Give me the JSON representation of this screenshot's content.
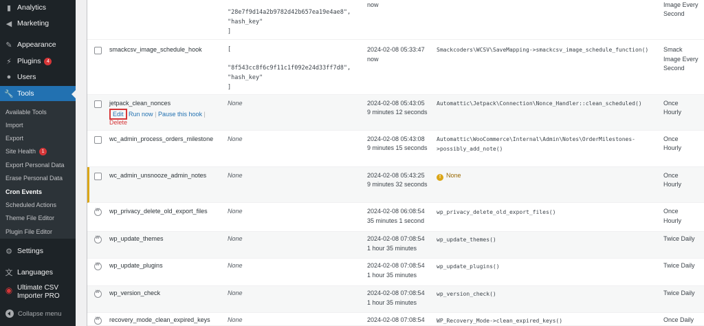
{
  "sidebar": {
    "items": [
      {
        "label": "Analytics",
        "icon": "bar-chart-icon"
      },
      {
        "label": "Marketing",
        "icon": "megaphone-icon"
      },
      {
        "label": "Appearance",
        "icon": "paintbrush-icon"
      },
      {
        "label": "Plugins",
        "icon": "plug-icon",
        "badge": "4"
      },
      {
        "label": "Users",
        "icon": "user-icon"
      },
      {
        "label": "Tools",
        "icon": "wrench-icon"
      },
      {
        "label": "Settings",
        "icon": "sliders-icon"
      },
      {
        "label": "Languages",
        "icon": "translate-icon"
      },
      {
        "label": "Ultimate CSV Importer PRO",
        "icon": "csv-importer-icon"
      }
    ],
    "submenu": [
      {
        "label": "Available Tools"
      },
      {
        "label": "Import"
      },
      {
        "label": "Export"
      },
      {
        "label": "Site Health",
        "badge": "1"
      },
      {
        "label": "Export Personal Data"
      },
      {
        "label": "Erase Personal Data"
      },
      {
        "label": "Cron Events"
      },
      {
        "label": "Scheduled Actions"
      },
      {
        "label": "Theme File Editor"
      },
      {
        "label": "Plugin File Editor"
      }
    ],
    "collapse_label": "Collapse menu"
  },
  "table": {
    "rows": [
      {
        "hook": "",
        "args_lines": [
          "\"28e7f9d14a2b9782d42b657ea19e4ae8\",",
          "    \"hash_key\"",
          "]"
        ],
        "next_run": [
          "",
          "now"
        ],
        "action": "",
        "recurrence": [
          "Image Every",
          "Second"
        ]
      },
      {
        "hook": "smackcsv_image_schedule_hook",
        "args_lines": [
          "[",
          "",
          "\"8f543cc8f6c9f11c1f092e24d33ff7d8\",",
          "    \"hash_key\"",
          "]"
        ],
        "next_run": [
          "2024-02-08 05:33:47",
          "now"
        ],
        "action": "Smackcoders\\WCSV\\SaveMapping->smackcsv_image_schedule_function()",
        "recurrence": [
          "Smack",
          "Image Every",
          "Second"
        ]
      },
      {
        "hook": "jetpack_clean_nonces",
        "args": "None",
        "next_run": [
          "2024-02-08 05:43:05",
          "9 minutes 12 seconds"
        ],
        "action": "Automattic\\Jetpack\\Connection\\Nonce_Handler::clean_scheduled()",
        "recurrence": [
          "Once",
          "Hourly"
        ],
        "row_actions": {
          "edit": "Edit",
          "run": "Run now",
          "pause": "Pause this hook",
          "sep": "|",
          "delete": "Delete"
        }
      },
      {
        "hook": "wc_admin_process_orders_milestone",
        "args": "None",
        "next_run": [
          "2024-02-08 05:43:08",
          "9 minutes 15 seconds"
        ],
        "action_lines": [
          "Automattic\\WooCommerce\\Internal\\Admin\\Notes\\OrderMilestones-",
          ">possibly_add_note()"
        ],
        "recurrence": [
          "Once",
          "Hourly"
        ]
      },
      {
        "hook": "wc_admin_unsnooze_admin_notes",
        "args": "None",
        "next_run": [
          "2024-02-08 05:43:25",
          "9 minutes 32 seconds"
        ],
        "action_warning": "None",
        "recurrence": [
          "Once",
          "Hourly"
        ]
      },
      {
        "hook": "wp_privacy_delete_old_export_files",
        "args": "None",
        "next_run": [
          "2024-02-08 06:08:54",
          "35 minutes 1 second"
        ],
        "action": "wp_privacy_delete_old_export_files()",
        "recurrence": [
          "Once",
          "Hourly"
        ]
      },
      {
        "hook": "wp_update_themes",
        "args": "None",
        "next_run": [
          "2024-02-08 07:08:54",
          "1 hour 35 minutes"
        ],
        "action": "wp_update_themes()",
        "recurrence": [
          "Twice Daily"
        ]
      },
      {
        "hook": "wp_update_plugins",
        "args": "None",
        "next_run": [
          "2024-02-08 07:08:54",
          "1 hour 35 minutes"
        ],
        "action": "wp_update_plugins()",
        "recurrence": [
          "Twice Daily"
        ]
      },
      {
        "hook": "wp_version_check",
        "args": "None",
        "next_run": [
          "2024-02-08 07:08:54",
          "1 hour 35 minutes"
        ],
        "action": "wp_version_check()",
        "recurrence": [
          "Twice Daily"
        ]
      },
      {
        "hook": "recovery_mode_clean_expired_keys",
        "args": "None",
        "next_run": [
          "2024-02-08 07:08:54",
          ""
        ],
        "action": "WP_Recovery_Mode->clean_expired_keys()",
        "recurrence": [
          "Once Daily"
        ]
      }
    ]
  },
  "colors": {
    "sidebar_bg": "#1d2327",
    "active": "#2271b1",
    "badge": "#d63638",
    "warning": "#dba617",
    "link": "#2271b1"
  }
}
